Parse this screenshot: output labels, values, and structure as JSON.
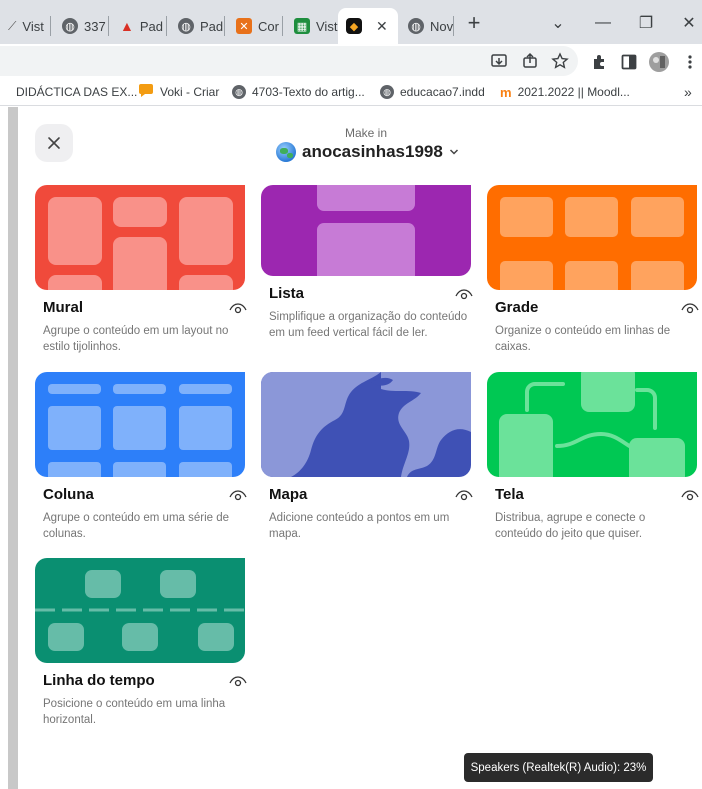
{
  "browser": {
    "tabs": [
      {
        "label": "Vist",
        "icon": "padlet-icon",
        "color": "#555"
      },
      {
        "label": "337",
        "icon": "globe-icon",
        "color": "#555"
      },
      {
        "label": "Pad",
        "icon": "triangle-icon",
        "color": "#d93025"
      },
      {
        "label": "Pad",
        "icon": "globe-icon",
        "color": "#555"
      },
      {
        "label": "Cor",
        "icon": "x-box-icon",
        "color": "#e8711a"
      },
      {
        "label": "Vist",
        "icon": "excel-icon",
        "color": "#1e8e3e"
      },
      {
        "label": "",
        "icon": "padlet-icon",
        "color": "#111"
      },
      {
        "label": "Nov",
        "icon": "globe-icon",
        "color": "#555"
      }
    ],
    "active_tab_close": "✕",
    "new_tab": "+",
    "window_controls": {
      "dropdown": "⌄",
      "minimize": "—",
      "restore": "❐",
      "close": "✕"
    },
    "bookmarks": [
      {
        "label": "DIDÁCTICA DAS EX...",
        "icon": "none"
      },
      {
        "label": "Voki - Criar",
        "icon": "voki-icon"
      },
      {
        "label": "4703-Texto do artig...",
        "icon": "globe-icon"
      },
      {
        "label": "educacao7.indd",
        "icon": "globe-icon"
      },
      {
        "label": "2021.2022 || Moodl...",
        "icon": "moodle-icon"
      }
    ],
    "bookmarks_more": "»"
  },
  "header": {
    "make_in": "Make in",
    "workspace": "anocasinhas1998"
  },
  "formats": [
    {
      "title": "Mural",
      "description": "Agrupe o conteúdo em um layout no estilo tijolinhos.",
      "color": "#f04a3b"
    },
    {
      "title": "Lista",
      "description": "Simplifique a organização do conteúdo em um feed vertical fácil de ler.",
      "color": "#9c27b0"
    },
    {
      "title": "Grade",
      "description": "Organize o conteúdo em linhas de caixas.",
      "color": "#ff6d00"
    },
    {
      "title": "Coluna",
      "description": "Agrupe o conteúdo em uma série de colunas.",
      "color": "#2d7ff9"
    },
    {
      "title": "Mapa",
      "description": "Adicione conteúdo a pontos em um mapa.",
      "color": "#3f51b5"
    },
    {
      "title": "Tela",
      "description": "Distribua, agrupe e conecte o conteúdo do jeito que quiser.",
      "color": "#00c853"
    },
    {
      "title": "Linha do tempo",
      "description": "Posicione o conteúdo em uma linha horizontal.",
      "color": "#0a8f71"
    }
  ],
  "toast": "Speakers (Realtek(R) Audio): 23%"
}
